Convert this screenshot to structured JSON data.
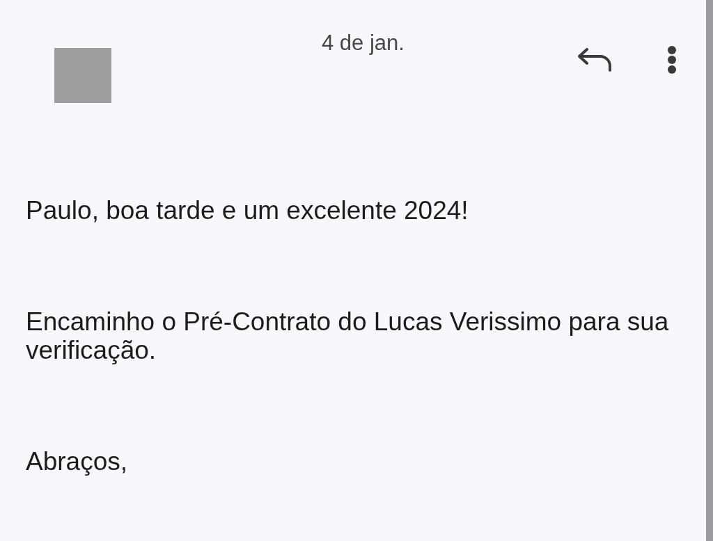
{
  "header": {
    "date": "4 de jan."
  },
  "message": {
    "paragraphs": [
      "Paulo, boa tarde e um excelente 2024!",
      "Encaminho o Pré-Contrato do Lucas Verissimo para sua verificação.",
      "Abraços,"
    ]
  }
}
